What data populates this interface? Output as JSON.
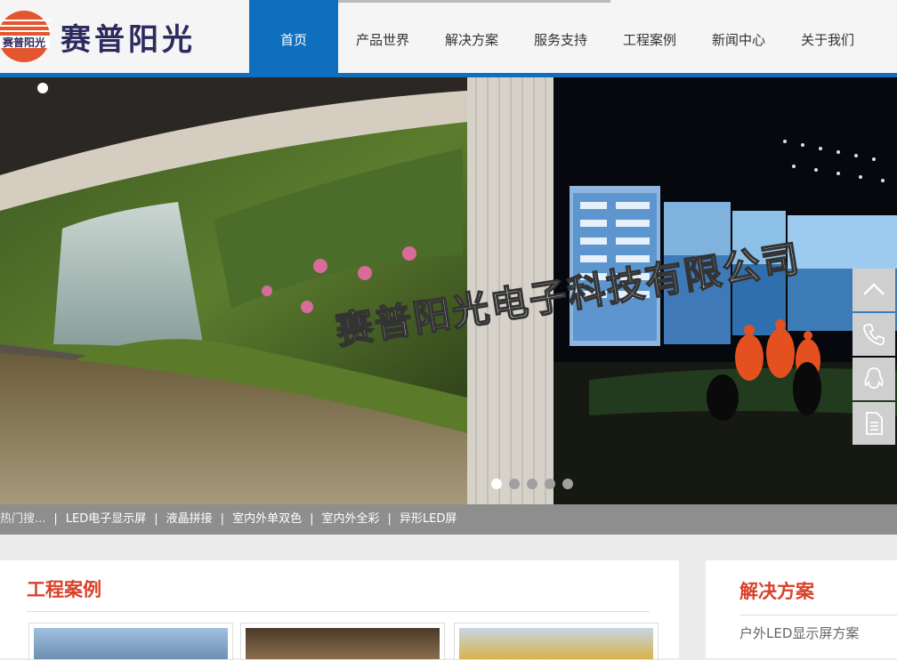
{
  "header": {
    "logo_text": "赛普阳光",
    "logo_mark_text": "赛普阳光",
    "nav": [
      {
        "label": "首页",
        "active": true
      },
      {
        "label": "产品世界"
      },
      {
        "label": "解决方案"
      },
      {
        "label": "服务支持"
      },
      {
        "label": "工程案例"
      },
      {
        "label": "新闻中心"
      },
      {
        "label": "关于我们"
      }
    ]
  },
  "hero": {
    "watermark": "赛普阳光电子科技有限公司",
    "slides_count": 5,
    "active_slide": 1
  },
  "side_tools": [
    {
      "icon": "arrow-up-icon"
    },
    {
      "icon": "phone-icon"
    },
    {
      "icon": "qq-icon"
    },
    {
      "icon": "document-icon"
    }
  ],
  "hot_search": {
    "label": "热门搜...",
    "items": [
      "LED电子显示屏",
      "液晶拼接",
      "室内外单双色",
      "室内外全彩",
      "异形LED屏"
    ]
  },
  "cases": {
    "title": "工程案例"
  },
  "solutions": {
    "title": "解决方案",
    "items": [
      "户外LED显示屏方案"
    ]
  },
  "colors": {
    "brand_blue": "#0d6fbd",
    "accent_red": "#d9412b",
    "logo_orange": "#e4572e",
    "logo_navy": "#2d2a5e"
  }
}
